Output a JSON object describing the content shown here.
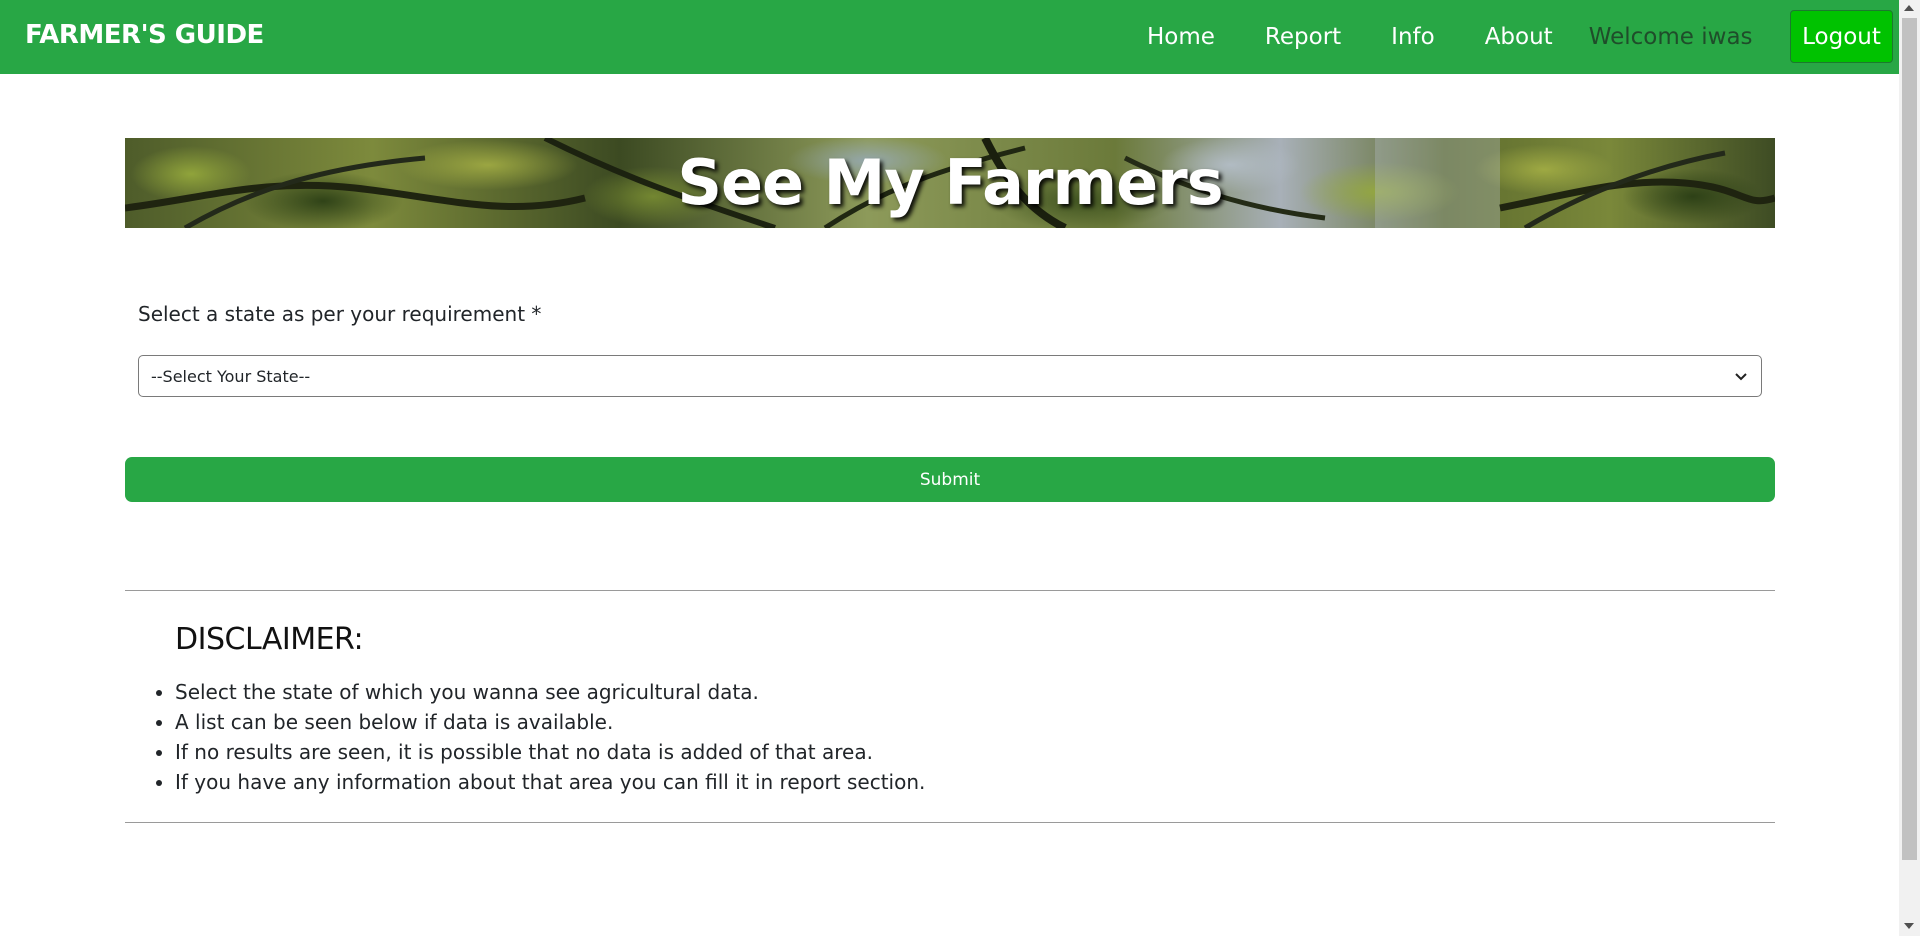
{
  "navbar": {
    "brand": "FARMER'S GUIDE",
    "links": [
      {
        "label": "Home"
      },
      {
        "label": "Report"
      },
      {
        "label": "Info"
      },
      {
        "label": "About"
      }
    ],
    "welcome": "Welcome iwas",
    "logout_label": "Logout",
    "colors": {
      "navbar_bg": "#28a745",
      "logout_bg": "#00c200"
    }
  },
  "banner": {
    "title": "See My Farmers"
  },
  "form": {
    "label": "Select a state as per your requirement *",
    "select": {
      "selected": "--Select Your State--"
    },
    "submit_label": "Submit"
  },
  "disclaimer": {
    "title": "DISCLAIMER:",
    "items": [
      "Select the state of which you wanna see agricultural data.",
      "A list can be seen below if data is available.",
      "If no results are seen, it is possible that no data is added of that area.",
      "If you have any information about that area you can fill it in report section."
    ]
  },
  "icons": {
    "select_arrow": "chevron-down-icon",
    "scroll_up": "scroll-up-arrow-icon",
    "scroll_down": "scroll-down-arrow-icon"
  }
}
